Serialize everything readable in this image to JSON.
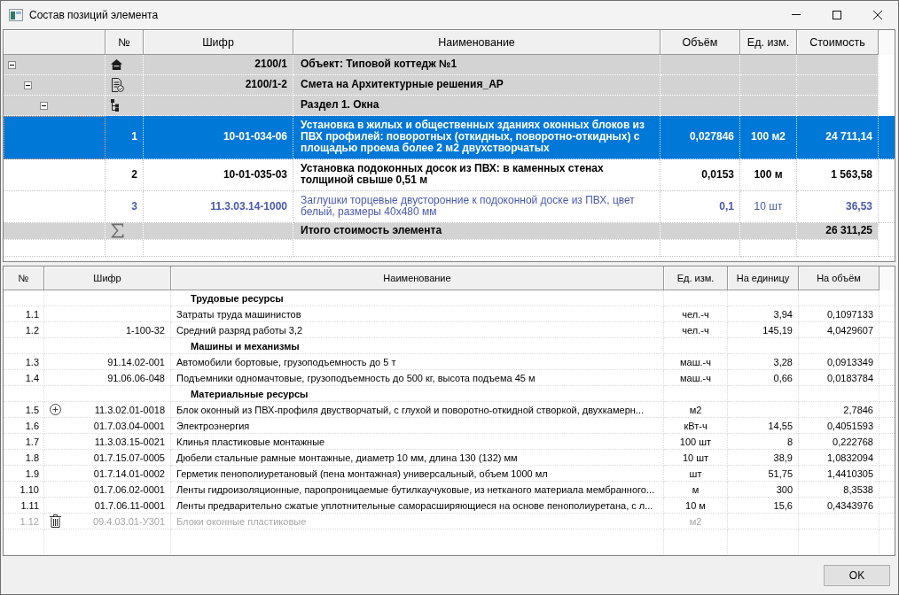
{
  "window": {
    "title": "Состав позиций элемента"
  },
  "positions_table": {
    "columns": [
      "№",
      "Шифр",
      "Наименование",
      "Объём",
      "Ед. изм.",
      "Стоимость"
    ],
    "rows": [
      {
        "kind": "object",
        "expanded": true,
        "selected": false,
        "code": "2100/1",
        "name": "Объект: Типовой коттедж №1",
        "children": [
          {
            "kind": "estimate",
            "expanded": true,
            "selected": false,
            "code": "2100/1-2",
            "name": "Смета на Архитектурные решения_АР",
            "children": [
              {
                "kind": "section",
                "expanded": true,
                "selected": false,
                "name": "Раздел 1. Окна",
                "children": [
                  {
                    "kind": "work",
                    "selected": true,
                    "number": "1",
                    "code": "10-01-034-06",
                    "name": "Установка в жилых и общественных зданиях оконных блоков из ПВХ профилей: поворотных (откидных, поворотно-откидных) с площадью проема более 2 м2 двухстворчатых",
                    "volume": "0,027846",
                    "unit": "100 м2",
                    "cost": "24 711,14"
                  },
                  {
                    "kind": "work",
                    "selected": false,
                    "number": "2",
                    "code": "10-01-035-03",
                    "name": "Установка подоконных досок из ПВХ: в каменных стенах толщиной свыше 0,51 м",
                    "volume": "0,0153",
                    "unit": "100 м",
                    "cost": "1 563,58"
                  },
                  {
                    "kind": "material",
                    "selected": false,
                    "number": "3",
                    "code": "11.3.03.14-1000",
                    "name": "Заглушки торцевые двусторонние к подоконной доске из ПВХ, цвет белый, размеры 40х480 мм",
                    "volume": "0,1",
                    "unit": "10 шт",
                    "cost": "36,53"
                  }
                ]
              }
            ]
          }
        ]
      }
    ],
    "total": {
      "name": "Итого стоимость элемента",
      "cost": "26 311,25"
    }
  },
  "resources_table": {
    "columns": [
      "№",
      "Шифр",
      "Наименование",
      "Ед. изм.",
      "На единицу",
      "На объём"
    ],
    "rows": [
      {
        "kind": "group",
        "name": "Трудовые ресурсы"
      },
      {
        "kind": "resource",
        "expandable": false,
        "deleted": false,
        "number": "1.1",
        "name": "Затраты труда машинистов",
        "unit": "чел.-ч",
        "per_unit": "3,94",
        "per_volume": "0,1097133"
      },
      {
        "kind": "resource",
        "expandable": false,
        "deleted": false,
        "number": "1.2",
        "code": "1-100-32",
        "name": "Средний разряд работы 3,2",
        "unit": "чел.-ч",
        "per_unit": "145,19",
        "per_volume": "4,0429607"
      },
      {
        "kind": "group",
        "name": "Машины и механизмы"
      },
      {
        "kind": "resource",
        "expandable": false,
        "deleted": false,
        "number": "1.3",
        "code": "91.14.02-001",
        "name": "Автомобили бортовые, грузоподъемность до 5 т",
        "unit": "маш.-ч",
        "per_unit": "3,28",
        "per_volume": "0,0913349"
      },
      {
        "kind": "resource",
        "expandable": false,
        "deleted": false,
        "number": "1.4",
        "code": "91.06.06-048",
        "name": "Подъемники одномачтовые, грузоподъемность до 500 кг, высота подъема 45 м",
        "unit": "маш.-ч",
        "per_unit": "0,66",
        "per_volume": "0,0183784"
      },
      {
        "kind": "group",
        "name": "Материальные ресурсы"
      },
      {
        "kind": "resource",
        "expandable": true,
        "deleted": false,
        "number": "1.5",
        "code": "11.3.02.01-0018",
        "name": "Блок оконный из ПВХ-профиля двустворчатый, с глухой и поворотно-откидной створкой, двухкамерн...",
        "unit": "м2",
        "per_volume": "2,7846"
      },
      {
        "kind": "resource",
        "expandable": false,
        "deleted": false,
        "number": "1.6",
        "code": "01.7.03.04-0001",
        "name": "Электроэнергия",
        "unit": "кВт-ч",
        "per_unit": "14,55",
        "per_volume": "0,4051593"
      },
      {
        "kind": "resource",
        "expandable": false,
        "deleted": false,
        "number": "1.7",
        "code": "11.3.03.15-0021",
        "name": "Клинья пластиковые монтажные",
        "unit": "100 шт",
        "per_unit": "8",
        "per_volume": "0,222768"
      },
      {
        "kind": "resource",
        "expandable": false,
        "deleted": false,
        "number": "1.8",
        "code": "01.7.15.07-0005",
        "name": "Дюбели стальные рамные монтажные, диаметр 10 мм, длина 130 (132) мм",
        "unit": "10 шт",
        "per_unit": "38,9",
        "per_volume": "1,0832094"
      },
      {
        "kind": "resource",
        "expandable": false,
        "deleted": false,
        "number": "1.9",
        "code": "01.7.14.01-0002",
        "name": "Герметик пенополиуретановый (пена монтажная) универсальный, объем 1000 мл",
        "unit": "шт",
        "per_unit": "51,75",
        "per_volume": "1,4410305"
      },
      {
        "kind": "resource",
        "expandable": false,
        "deleted": false,
        "number": "1.10",
        "code": "01.7.06.02-0001",
        "name": "Ленты гидроизоляционные, паропроницаемые бутилкаучуковые, из нетканого материала мембранного...",
        "unit": "м",
        "per_unit": "300",
        "per_volume": "8,3538"
      },
      {
        "kind": "resource",
        "expandable": false,
        "deleted": false,
        "number": "1.11",
        "code": "01.7.06.11-0001",
        "name": "Ленты предварительно сжатые уплотнительные саморасширяющиеся на основе пенополиуретана, с л...",
        "unit": "10 м",
        "per_unit": "15,6",
        "per_volume": "0,4343976"
      },
      {
        "kind": "resource",
        "expandable": false,
        "deleted": true,
        "number": "1.12",
        "code": "09.4.03.01-У301",
        "name": "Блоки оконные пластиковые",
        "unit": "м2"
      }
    ]
  },
  "buttons": [
    "OK"
  ]
}
